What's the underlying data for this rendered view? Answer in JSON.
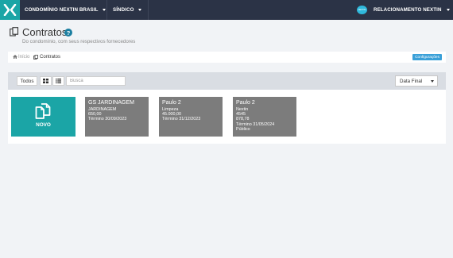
{
  "topbar": {
    "org": "CONDOMÍNIO NEXTIN BRASIL",
    "role": "SÍNDICO",
    "avatar_text": "NEXTIN",
    "user": "RELACIONAMENTO NEXTIN"
  },
  "header": {
    "title": "Contratos",
    "subtitle": "Do condomínio, com seus respectivos fornecedores",
    "help": "?"
  },
  "breadcrumb": {
    "home": "Início",
    "current": "Contratos",
    "config_button": "Configurações"
  },
  "toolbar": {
    "filter_all": "Todos",
    "search_placeholder": "Busca",
    "sort_selected": "Data Final"
  },
  "new_card": {
    "label": "NOVO"
  },
  "contracts": [
    {
      "title": "GS JARDINAGEM",
      "lines": [
        "JARDINAGEM",
        "650,00",
        "Término 30/09/2023"
      ]
    },
    {
      "title": "Paulo 2",
      "lines": [
        "Limpeza",
        "45.000,00",
        "Término 31/12/2023"
      ]
    },
    {
      "title": "Paulo 2",
      "lines": [
        "Nextin",
        "4545",
        "878,78",
        "Término 31/05/2024",
        "Público"
      ]
    }
  ],
  "colors": {
    "topbar": "#2b3346",
    "accent": "#1ba5a6",
    "card": "#7c7c7c",
    "config_button": "#3aa0d8"
  },
  "icons": [
    "menu-x-logo-icon",
    "contracts-icon",
    "help-icon",
    "home-icon",
    "grid-view-icon",
    "list-view-icon",
    "new-contract-icon",
    "caret-down-icon"
  ]
}
